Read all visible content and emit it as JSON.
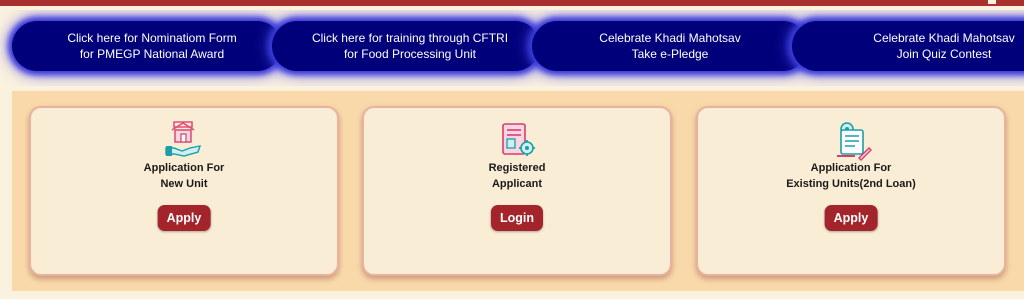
{
  "links": [
    {
      "line1": "Click here for Nominatiom Form",
      "line2": "for PMEGP National Award"
    },
    {
      "line1": "Click here for training through CFTRI",
      "line2": "for Food Processing Unit"
    },
    {
      "line1": "Celebrate Khadi Mahotsav",
      "line2": "Take e-Pledge"
    },
    {
      "line1": "Celebrate Khadi Mahotsav",
      "line2": "Join Quiz Contest"
    }
  ],
  "cards": [
    {
      "title_line1": "Application For",
      "title_line2": "New Unit",
      "button": "Apply",
      "icon": "hand-house-icon"
    },
    {
      "title_line1": "Registered",
      "title_line2": "Applicant",
      "button": "Login",
      "icon": "document-gear-icon"
    },
    {
      "title_line1": "Application For",
      "title_line2": "Existing Units(2nd Loan)",
      "button": "Apply",
      "icon": "form-pen-gear-icon"
    }
  ],
  "colors": {
    "pill_bg": "#00007a",
    "button_bg": "#a3252b",
    "panel_bg": "#f9d9aa",
    "card_bg": "#faedd6",
    "top_strip": "#a8302f"
  }
}
